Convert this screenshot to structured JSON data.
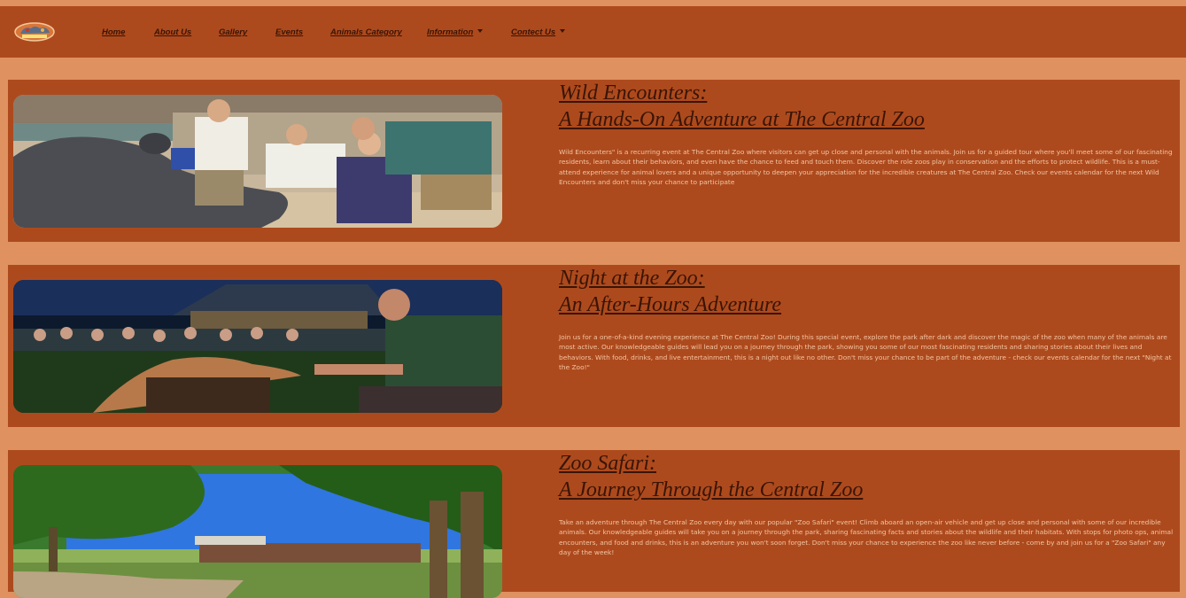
{
  "nav": {
    "items": [
      {
        "label": "Home"
      },
      {
        "label": "About Us"
      },
      {
        "label": "Gallery"
      },
      {
        "label": "Events"
      },
      {
        "label": "Animals Category"
      },
      {
        "label": "Information"
      },
      {
        "label": "Contect Us"
      }
    ]
  },
  "events": [
    {
      "title_line1": "Wild Encounters:",
      "title_line2": "A Hands-On Adventure at The Central Zoo",
      "description": "Wild Encounters\" is a recurring event at The Central Zoo where visitors can get up close and personal with the animals. Join us for a guided tour where you'll meet some of our fascinating residents, learn about their behaviors, and even have the chance to feed and touch them. Discover the role zoos play in conservation and the efforts to protect wildlife. This is a must-attend experience for animal lovers and a unique opportunity to deepen your appreciation for the incredible creatures at The Central Zoo. Check our events calendar for the next Wild Encounters and don't miss your chance to participate"
    },
    {
      "title_line1": "Night at the Zoo:",
      "title_line2": "An After-Hours Adventure",
      "description": "Join us for a one-of-a-kind evening experience at The Central Zoo! During this special event, explore the park after dark and discover the magic of the zoo when many of the animals are most active. Our knowledgeable guides will lead you on a journey through the park, showing you some of our most fascinating residents and sharing stories about their lives and behaviors. With food, drinks, and live entertainment, this is a night out like no other. Don't miss your chance to be part of the adventure - check our events calendar for the next \"Night at the Zoo!\""
    },
    {
      "title_line1": "Zoo Safari:",
      "title_line2": "A Journey Through the Central Zoo",
      "description": "Take an adventure through The Central Zoo every day with our popular \"Zoo Safari\" event! Climb aboard an open-air vehicle and get up close and personal with some of our incredible animals. Our knowledgeable guides will take you on a journey through the park, sharing fascinating facts and stories about the wildlife and their habitats. With stops for photo ops, animal encounters, and food and drinks, this is an adventure you won't soon forget. Don't miss your chance to experience the zoo like never before - come by and join us for a \"Zoo Safari\" any day of the week!"
    }
  ]
}
